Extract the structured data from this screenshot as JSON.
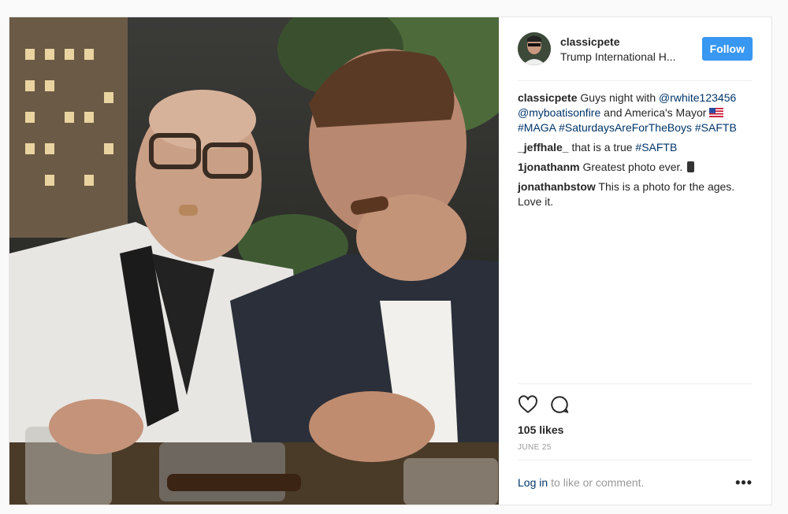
{
  "post": {
    "author": "classicpete",
    "location": "Trump International H...",
    "follow_label": "Follow",
    "caption": {
      "user": "classicpete",
      "text_1": "Guys night with",
      "mention_1": "@rwhite123456",
      "mention_2": "@myboatisonfire",
      "text_2": "and America's Mayor",
      "hashtag_1": "#MAGA",
      "hashtag_2": "#SaturdaysAreForTheBoys",
      "hashtag_3": "#SAFTB"
    },
    "comments": [
      {
        "user": "_jeffhale_",
        "text": "that is a true",
        "hashtag": "#SAFTB"
      },
      {
        "user": "1jonathanm",
        "text": "Greatest photo ever."
      },
      {
        "user": "jonathanbstow",
        "text": "This is a photo for the ages. Love it."
      }
    ],
    "likes": "105 likes",
    "date": "JUNE 25",
    "login_link": "Log in",
    "login_text": "to like or comment.",
    "more_label": "•••"
  },
  "icons": {
    "like": "heart-icon",
    "comment": "comment-icon",
    "flag": "us-flag-emoji",
    "phone": "mobile-phone-emoji"
  },
  "colors": {
    "follow_button": "#3897f0",
    "link": "#003569",
    "border": "#efefef"
  }
}
